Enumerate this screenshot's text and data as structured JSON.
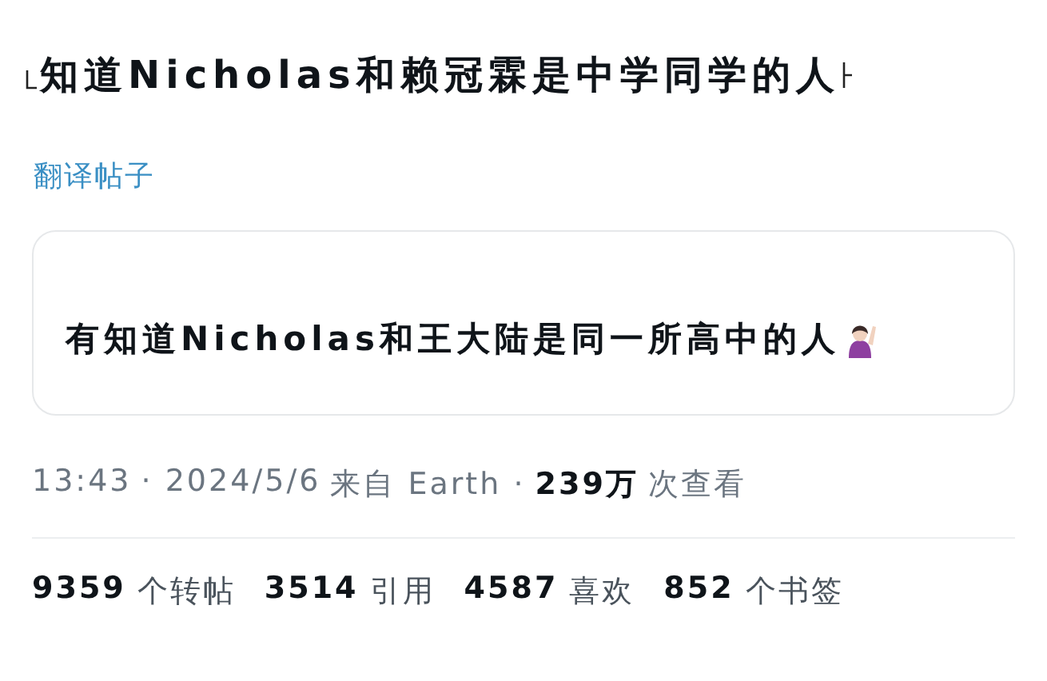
{
  "post": {
    "text": "知道Nicholas和赖冠霖是中学同学的人"
  },
  "translate_link": "翻译帖子",
  "quoted_post": {
    "text": "有知道Nicholas和王大陆是同一所高中的人"
  },
  "meta": {
    "time": "13:43",
    "date": "· 2024/5/6",
    "source": "来自 Earth ·",
    "views_count": "239万",
    "views_label": "次查看"
  },
  "stats": [
    {
      "count": "9359",
      "label": "个转帖"
    },
    {
      "count": "3514",
      "label": "引用"
    },
    {
      "count": "4587",
      "label": "喜欢"
    },
    {
      "count": "852",
      "label": "个书签"
    }
  ]
}
